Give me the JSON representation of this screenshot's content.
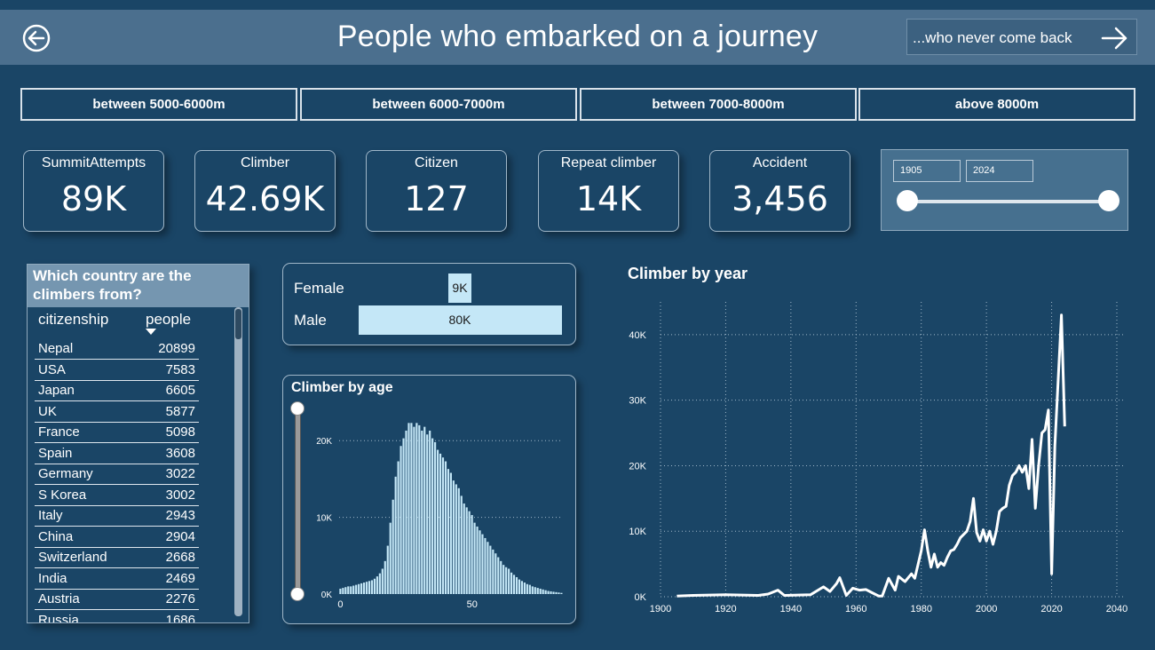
{
  "header": {
    "title": "People who embarked on a journey",
    "next_label": "...who never come back"
  },
  "ranges": [
    "between 5000-6000m",
    "between 6000-7000m",
    "between 7000-8000m",
    "above 8000m"
  ],
  "kpis": [
    {
      "label": "SummitAttempts",
      "value": "89K"
    },
    {
      "label": "Climber",
      "value": "42.69K"
    },
    {
      "label": "Citizen",
      "value": "127"
    },
    {
      "label": "Repeat climber",
      "value": "14K"
    },
    {
      "label": "Accident",
      "value": "3,456"
    }
  ],
  "year_slider": {
    "from": "1905",
    "to": "2024"
  },
  "country_table": {
    "title": "Which country are the climbers from?",
    "col1": "citizenship",
    "col2": "people",
    "rows": [
      {
        "country": "Nepal",
        "people": "20899"
      },
      {
        "country": "USA",
        "people": "7583"
      },
      {
        "country": "Japan",
        "people": "6605"
      },
      {
        "country": "UK",
        "people": "5877"
      },
      {
        "country": "France",
        "people": "5098"
      },
      {
        "country": "Spain",
        "people": "3608"
      },
      {
        "country": "Germany",
        "people": "3022"
      },
      {
        "country": "S Korea",
        "people": "3002"
      },
      {
        "country": "Italy",
        "people": "2943"
      },
      {
        "country": "China",
        "people": "2904"
      },
      {
        "country": "Switzerland",
        "people": "2668"
      },
      {
        "country": "India",
        "people": "2469"
      },
      {
        "country": "Austria",
        "people": "2276"
      },
      {
        "country": "Russia",
        "people": "1686"
      }
    ]
  },
  "colors": {
    "background": "#1a4566",
    "bar": "#c4e7f7",
    "header": "#4b6f8e",
    "line": "#ffffff"
  },
  "chart_data": [
    {
      "type": "bar",
      "orientation": "horizontal",
      "categories": [
        "Female",
        "Male"
      ],
      "values": [
        9000,
        80000
      ],
      "data_labels": [
        "9K",
        "80K"
      ]
    },
    {
      "type": "bar",
      "title": "Climber by age",
      "x": [
        0,
        1,
        2,
        3,
        4,
        5,
        6,
        7,
        8,
        9,
        10,
        11,
        12,
        13,
        14,
        15,
        16,
        17,
        18,
        19,
        20,
        21,
        22,
        23,
        24,
        25,
        26,
        27,
        28,
        29,
        30,
        31,
        32,
        33,
        34,
        35,
        36,
        37,
        38,
        39,
        40,
        41,
        42,
        43,
        44,
        45,
        46,
        47,
        48,
        49,
        50,
        51,
        52,
        53,
        54,
        55,
        56,
        57,
        58,
        59,
        60,
        61,
        62,
        63,
        64,
        65,
        66,
        67,
        68,
        69,
        70,
        71,
        72,
        73,
        74,
        75,
        76,
        77,
        78,
        79,
        80,
        81,
        82,
        83,
        84
      ],
      "values": [
        700,
        800,
        900,
        1000,
        1000,
        1100,
        1200,
        1300,
        1400,
        1500,
        1600,
        1700,
        1800,
        2000,
        2300,
        2700,
        3300,
        4300,
        6300,
        9300,
        12300,
        15300,
        17300,
        19300,
        20300,
        21300,
        22300,
        22300,
        21800,
        22300,
        22000,
        21300,
        21800,
        20800,
        21300,
        20300,
        19800,
        18800,
        18300,
        17800,
        17300,
        16300,
        15800,
        14800,
        14300,
        13800,
        12800,
        11800,
        11300,
        10800,
        10300,
        9300,
        8800,
        8300,
        7800,
        7300,
        6800,
        6300,
        5800,
        5300,
        4800,
        4300,
        3800,
        3500,
        3300,
        2800,
        2500,
        2200,
        1900,
        1700,
        1500,
        1300,
        1200,
        1000,
        900,
        800,
        700,
        600,
        500,
        400,
        350,
        300,
        250,
        200,
        150
      ],
      "xticks": [
        0,
        50
      ],
      "yticks": [
        "0K",
        "10K",
        "20K"
      ],
      "ylim": [
        0,
        25000
      ]
    },
    {
      "type": "line",
      "title": "Climber by year",
      "x": [
        1905,
        1910,
        1920,
        1930,
        1933,
        1936,
        1938,
        1946,
        1950,
        1952,
        1954,
        1955,
        1957,
        1959,
        1961,
        1963,
        1965,
        1967,
        1968,
        1970,
        1972,
        1973,
        1975,
        1977,
        1978,
        1980,
        1981,
        1982,
        1983,
        1984,
        1985,
        1986,
        1987,
        1988,
        1989,
        1990,
        1991,
        1992,
        1993,
        1994,
        1995,
        1996,
        1997,
        1998,
        1999,
        2000,
        2001,
        2002,
        2003,
        2004,
        2005,
        2006,
        2007,
        2008,
        2009,
        2010,
        2011,
        2012,
        2013,
        2014,
        2015,
        2016,
        2017,
        2018,
        2019,
        2020,
        2021,
        2022,
        2023,
        2024
      ],
      "values": [
        100,
        200,
        300,
        200,
        400,
        1000,
        200,
        300,
        1500,
        800,
        2000,
        2900,
        200,
        1300,
        1000,
        1100,
        600,
        100,
        100,
        2800,
        1000,
        3100,
        2300,
        3500,
        2800,
        7000,
        10200,
        7000,
        4500,
        6500,
        4500,
        5200,
        4800,
        6000,
        7000,
        7200,
        8000,
        9000,
        9500,
        10000,
        11500,
        15000,
        9800,
        8500,
        10200,
        8500,
        10000,
        8000,
        10000,
        13000,
        13500,
        13800,
        17000,
        18500,
        19000,
        20000,
        19000,
        20000,
        16500,
        24000,
        13500,
        20000,
        25000,
        25500,
        28500,
        3500,
        23000,
        33000,
        43000,
        26000
      ],
      "xticks": [
        1900,
        1920,
        1940,
        1960,
        1980,
        2000,
        2020,
        2040
      ],
      "yticks": [
        "0K",
        "10K",
        "20K",
        "30K",
        "40K"
      ],
      "ylim": [
        0,
        45000
      ],
      "grid": true
    }
  ]
}
